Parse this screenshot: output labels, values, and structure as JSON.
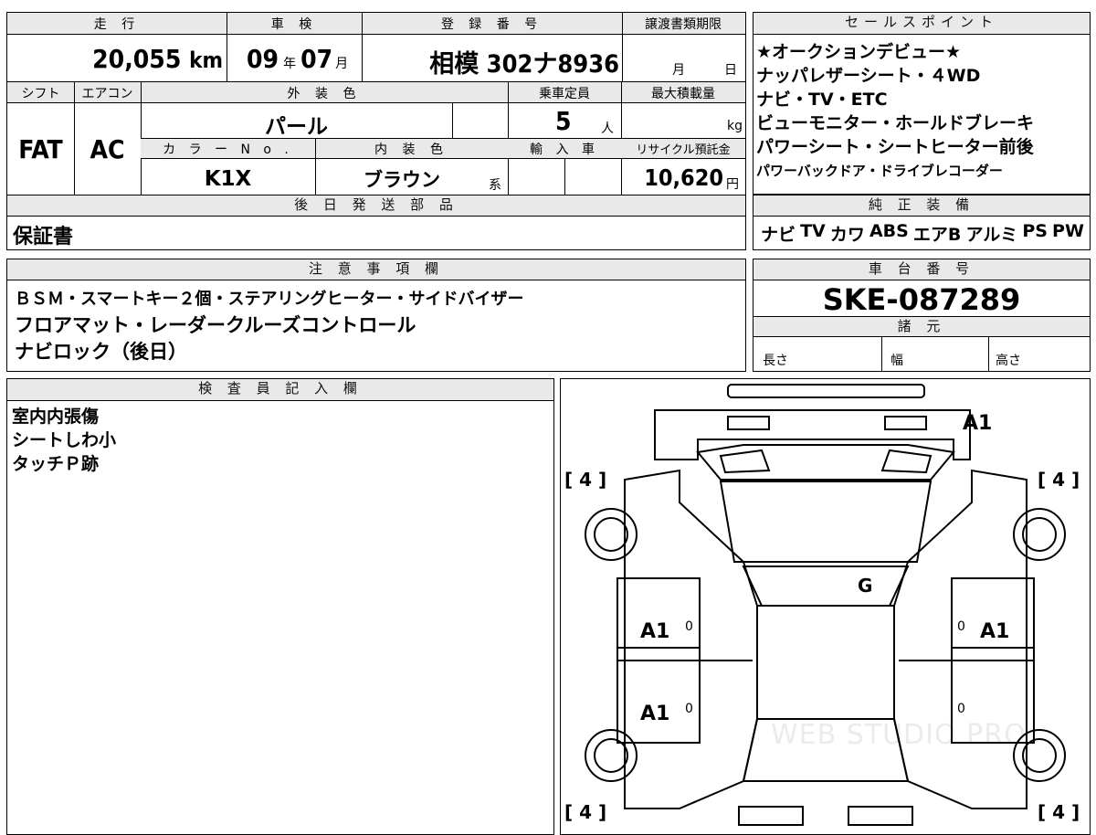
{
  "top_info": {
    "headers": {
      "mileage": "走 行",
      "inspection": "車 検",
      "registration": "登 録 番 号",
      "transfer_deadline": "譲渡書類期限"
    },
    "mileage_value": "20,055",
    "mileage_unit": "km",
    "inspection_year": "09",
    "inspection_year_unit": "年",
    "inspection_month": "07",
    "inspection_month_unit": "月",
    "registration_number": "相模 302ナ8936",
    "deadline_month": "月",
    "deadline_day": "日"
  },
  "specs": {
    "headers": {
      "shift": "シフト",
      "aircon": "エアコン",
      "exterior_color": "外 装 色",
      "capacity": "乗車定員",
      "max_load": "最大積載量",
      "color_no": "カ ラ ー N o .",
      "interior_color": "内 装 色",
      "import": "輸 入 車",
      "recycle_fee": "リサイクル預託金"
    },
    "shift_value": "FAT",
    "aircon_value": "AC",
    "exterior_color_value": "パール",
    "capacity_value": "5",
    "capacity_unit": "人",
    "max_load_unit": "kg",
    "color_no_value": "K1X",
    "interior_color_value": "ブラウン",
    "interior_suffix": "系",
    "recycle_value": "10,620",
    "recycle_unit": "円"
  },
  "later_parts": {
    "header": "後 日 発 送 部 品",
    "value": "保証書"
  },
  "sales_points": {
    "header": "セールスポイント",
    "lines": [
      "★オークションデビュー★",
      "ナッパレザーシート・４WD",
      "ナビ・TV・ETC",
      "ビューモニター・ホールドブレーキ",
      "パワーシート・シートヒーター前後",
      "パワーバックドア・ドライブレコーダー"
    ]
  },
  "genuine_equipment": {
    "header": "純 正 装 備",
    "items": [
      "ナビ",
      "TV",
      "カワ",
      "ABS",
      "エアB",
      "アルミ",
      "PS",
      "PW"
    ]
  },
  "notes": {
    "header": "注 意 事 項 欄",
    "lines": [
      "ＢＳＭ・スマートキー２個・ステアリングヒーター・サイドバイザー",
      "フロアマット・レーダークルーズコントロール",
      "ナビロック（後日）"
    ]
  },
  "chassis": {
    "header": "車 台 番 号",
    "value": "SKE-087289"
  },
  "dimensions": {
    "header": "諸 元",
    "length": "長さ",
    "width": "幅",
    "height": "高さ"
  },
  "inspector": {
    "header": "検 査 員 記 入 欄",
    "lines": [
      "室内内張傷",
      "シートしわ小",
      "タッチＰ跡"
    ]
  },
  "diagram": {
    "tire_front_left": "[ 4 ]",
    "tire_front_right": "[ 4 ]",
    "tire_rear_left": "[ 4 ]",
    "tire_rear_right": "[ 4 ]",
    "mark_front": "A1",
    "mark_windshield": "G",
    "mark_left_front_door": "A1",
    "mark_right_front_door": "A1",
    "mark_left_rear_door": "A1",
    "zero_1": "0",
    "zero_2": "0",
    "zero_3": "0",
    "zero_4": "0",
    "watermark": "WEB STUDIO PRO"
  }
}
